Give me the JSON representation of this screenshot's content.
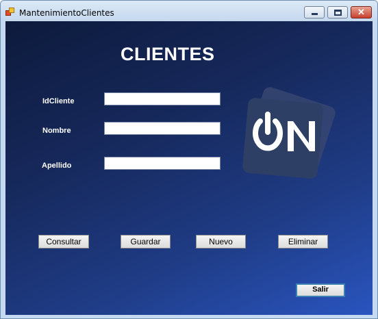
{
  "window": {
    "title": "MantenimientoClientes",
    "controls": {
      "minimize": "minimize-icon",
      "maximize": "maximize-icon",
      "close": "close-icon"
    }
  },
  "form": {
    "heading": "CLIENTES",
    "fields": [
      {
        "label": "IdCliente",
        "value": ""
      },
      {
        "label": "Nombre",
        "value": ""
      },
      {
        "label": "Apellido",
        "value": ""
      }
    ],
    "buttons": {
      "consultar": "Consultar",
      "guardar": "Guardar",
      "nuevo": "Nuevo",
      "eliminar": "Eliminar",
      "salir": "Salir"
    },
    "logo_text": "ON"
  },
  "colors": {
    "background_dark": "#0d1a3c",
    "background_light": "#2a55bf",
    "logo_card": "#2e3f66"
  }
}
